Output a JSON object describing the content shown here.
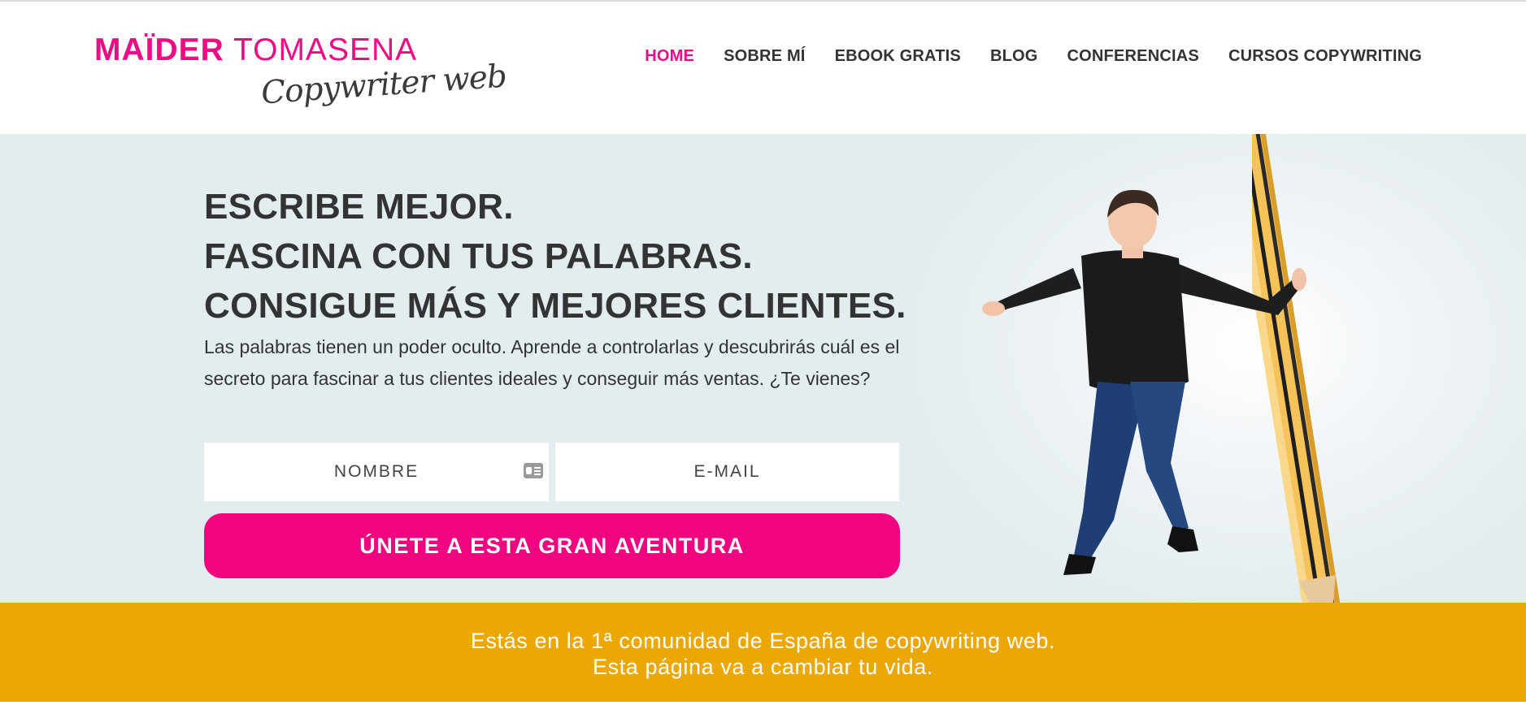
{
  "brand": {
    "name_bold": "MAÏDER",
    "name_light": "TOMASENA",
    "tagline": "Copywriter web",
    "color_primary": "#ec0c84"
  },
  "nav": {
    "items": [
      {
        "label": "HOME",
        "active": true
      },
      {
        "label": "SOBRE MÍ"
      },
      {
        "label": "EBOOK GRATIS"
      },
      {
        "label": "BLOG"
      },
      {
        "label": "CONFERENCIAS"
      },
      {
        "label": "CURSOS COPYWRITING"
      }
    ]
  },
  "hero": {
    "headline": [
      "ESCRIBE MEJOR.",
      "FASCINA CON TUS PALABRAS.",
      "CONSIGUE MÁS Y MEJORES CLIENTES."
    ],
    "lead": "Las palabras tienen un poder oculto. Aprende a controlarlas y descubrirás cuál es el secreto para fascinar a tus clientes ideales y conseguir más ventas. ¿Te vienes?",
    "form": {
      "name_placeholder": "NOMBRE",
      "email_placeholder": "E-MAIL",
      "name_icon": "id-card-icon",
      "submit_label": "ÚNETE A ESTA GRAN AVENTURA"
    },
    "image": "woman-leaning-on-giant-pencil"
  },
  "banner": {
    "line1": "Estás en la 1ª comunidad de España de copywriting web.",
    "line2": "Esta página va a cambiar tu vida.",
    "color": "#eba703"
  }
}
